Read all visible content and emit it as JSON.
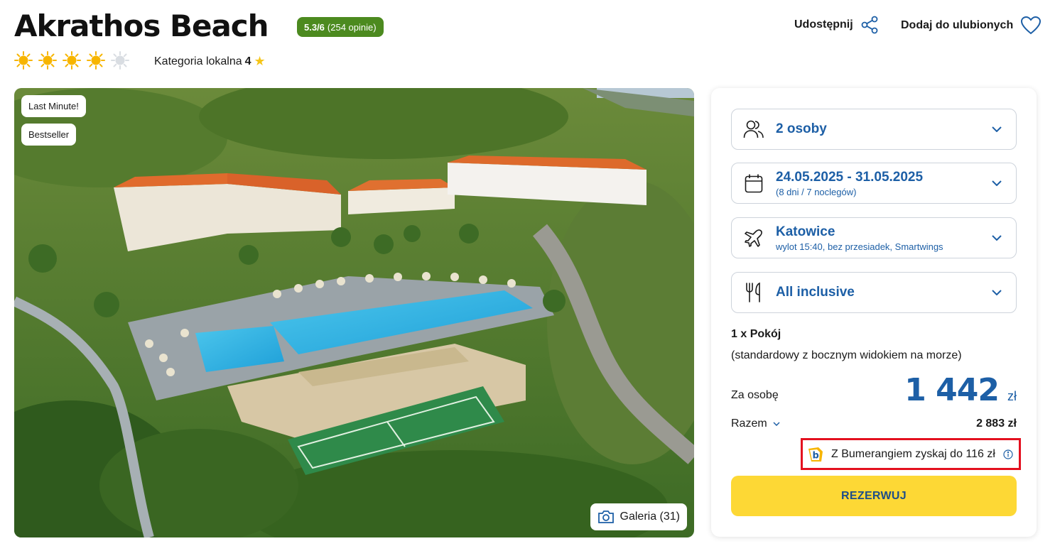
{
  "hotel": {
    "name": "Akrathos Beach",
    "rating_score": "5.3/6",
    "rating_reviews": "(254 opinie)",
    "suns_filled": 4,
    "suns_total": 5,
    "local_category_label": "Kategoria lokalna",
    "local_category_value": "4"
  },
  "actions": {
    "share_label": "Udostępnij",
    "favorite_label": "Dodaj do ulubionych"
  },
  "photo": {
    "tags": [
      "Last Minute!",
      "Bestseller"
    ],
    "gallery_label": "Galeria (31)"
  },
  "booking": {
    "travelers": "2 osoby",
    "dates": "24.05.2025 - 31.05.2025",
    "dates_sub": "(8 dni / 7 noclegów)",
    "departure": "Katowice",
    "departure_sub": "wylot 15:40, bez przesiadek, Smartwings",
    "board": "All inclusive",
    "room_count": "1 x Pokój",
    "room_type": "(standardowy z bocznym widokiem na morze)",
    "per_person_label": "Za osobę",
    "price_amount": "1 442",
    "price_currency": "zł",
    "total_label": "Razem",
    "total_value": "2 883 zł",
    "bumerang_text": "Z Bumerangiem zyskaj do 116 zł",
    "book_label": "REZERWUJ"
  },
  "colors": {
    "accent_blue": "#1d5fa6",
    "rating_green": "#4c8a1f",
    "cta_yellow": "#fdd835",
    "highlight_red": "#e3101f",
    "sun_yellow": "#f7b500"
  },
  "icons": {
    "share": "share-icon",
    "favorite": "heart-icon",
    "travelers": "users-icon",
    "dates": "calendar-icon",
    "departure": "airplane-icon",
    "board": "fork-knife-icon",
    "gallery": "camera-icon",
    "info": "info-icon",
    "bumerang": "bumerang-logo"
  }
}
